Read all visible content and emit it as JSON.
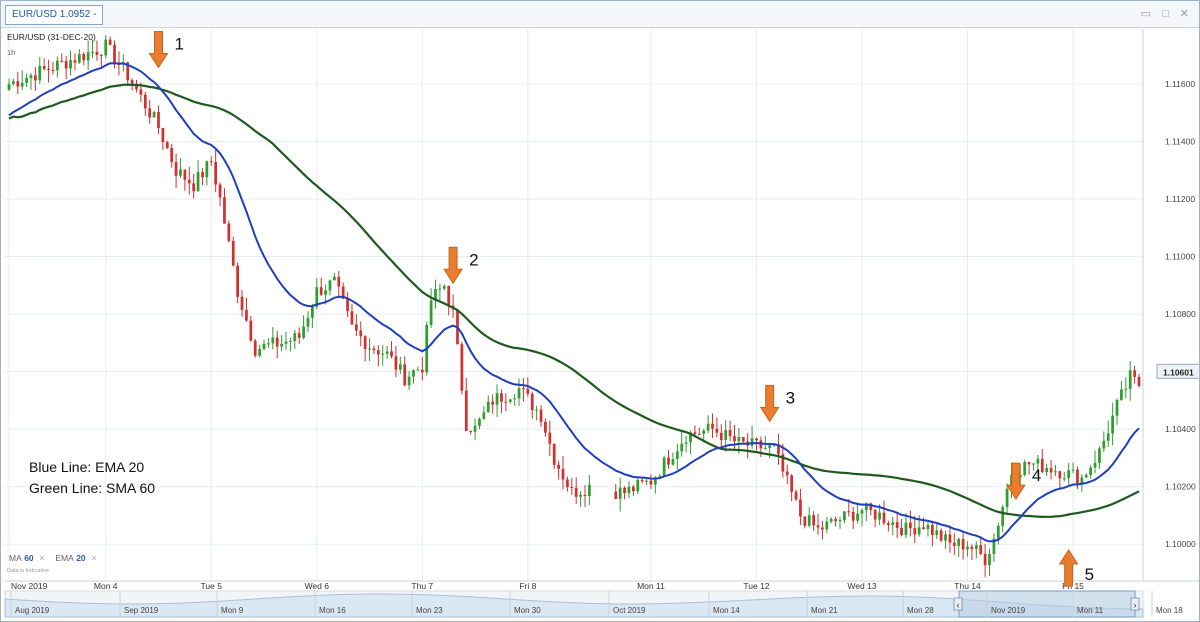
{
  "window": {
    "tab_label": "EUR/USD 1.0952 -",
    "controls": [
      "▭",
      "□",
      "✕"
    ]
  },
  "chart_data": {
    "type": "candlestick",
    "symbol_label": "EUR/USD (31-DEC-20)",
    "interval_label": "1h",
    "ylim": [
      1.099,
      1.1177
    ],
    "y_ticks": [
      "1.11600",
      "1.11400",
      "1.11200",
      "1.11000",
      "1.10800",
      "1.10600",
      "1.10400",
      "1.10200",
      "1.10000"
    ],
    "y_tick_values": [
      1.116,
      1.114,
      1.112,
      1.11,
      1.108,
      1.106,
      1.104,
      1.102,
      1.1
    ],
    "current_price_label": "1.10601",
    "current_price": 1.10601,
    "x_tick_labels": [
      "Nov 2019",
      "Mon 4",
      "Tue 5",
      "Wed 6",
      "Thu 7",
      "Fri 8",
      "Mon 11",
      "Tue 12",
      "Wed 13",
      "Thu 14",
      "Fri 15"
    ],
    "x_tick_positions": [
      0,
      22,
      46,
      70,
      94,
      118,
      146,
      170,
      194,
      218,
      242
    ],
    "total_bars": 258,
    "grid": true,
    "colors": {
      "up": "#2e9e2e",
      "down": "#d32f2f",
      "ema": "#1f3fbf",
      "sma": "#1e5a1e",
      "arrow": "#e87d2f"
    },
    "anchors": [
      [
        0,
        1.116
      ],
      [
        22,
        1.1173
      ],
      [
        27,
        1.1163
      ],
      [
        34,
        1.1145
      ],
      [
        38,
        1.113
      ],
      [
        42,
        1.1125
      ],
      [
        46,
        1.1133
      ],
      [
        48,
        1.112
      ],
      [
        52,
        1.1088
      ],
      [
        56,
        1.1068
      ],
      [
        62,
        1.107
      ],
      [
        66,
        1.1072
      ],
      [
        70,
        1.1088
      ],
      [
        74,
        1.1091
      ],
      [
        78,
        1.1075
      ],
      [
        82,
        1.1069
      ],
      [
        86,
        1.1066
      ],
      [
        90,
        1.1058
      ],
      [
        94,
        1.1062
      ],
      [
        96,
        1.1085
      ],
      [
        99,
        1.109
      ],
      [
        101,
        1.108
      ],
      [
        104,
        1.1042
      ],
      [
        106,
        1.104
      ],
      [
        110,
        1.105
      ],
      [
        116,
        1.1054
      ],
      [
        121,
        1.1045
      ],
      [
        124,
        1.103
      ],
      [
        128,
        1.1018
      ],
      [
        132,
        1.102
      ],
      [
        140,
        1.1018
      ],
      [
        146,
        1.1022
      ],
      [
        150,
        1.103
      ],
      [
        154,
        1.1038
      ],
      [
        160,
        1.104
      ],
      [
        166,
        1.1035
      ],
      [
        170,
        1.1034
      ],
      [
        174,
        1.1033
      ],
      [
        176,
        1.1025
      ],
      [
        180,
        1.101
      ],
      [
        184,
        1.1005
      ],
      [
        188,
        1.1008
      ],
      [
        194,
        1.1012
      ],
      [
        198,
        1.101
      ],
      [
        204,
        1.1005
      ],
      [
        208,
        1.1007
      ],
      [
        214,
        1.1
      ],
      [
        218,
        1.1
      ],
      [
        222,
        1.0995
      ],
      [
        224,
        1.1002
      ],
      [
        228,
        1.1025
      ],
      [
        232,
        1.1028
      ],
      [
        236,
        1.1027
      ],
      [
        240,
        1.1025
      ],
      [
        244,
        1.1023
      ],
      [
        248,
        1.1032
      ],
      [
        252,
        1.1048
      ],
      [
        255,
        1.1058
      ],
      [
        257,
        1.1055
      ]
    ],
    "gaps": [
      [
        133,
        137
      ]
    ],
    "ema_period": 20,
    "sma_period": 60,
    "annotations": [
      {
        "label": "1",
        "bar": 34,
        "price": 1.1165,
        "direction": "down"
      },
      {
        "label": "2",
        "bar": 101,
        "price": 1.109,
        "direction": "down"
      },
      {
        "label": "3",
        "bar": 173,
        "price": 1.1042,
        "direction": "down"
      },
      {
        "label": "4",
        "bar": 229,
        "price": 1.1015,
        "direction": "down"
      },
      {
        "label": "5",
        "bar": 241,
        "price": 1.0998,
        "direction": "up"
      }
    ],
    "legend_text": [
      "Blue Line: EMA 20",
      "Green Line: SMA 60"
    ],
    "indicators": [
      {
        "name": "MA",
        "value": "60",
        "close": "×"
      },
      {
        "name": "EMA",
        "value": "20",
        "close": "×"
      }
    ],
    "data_note": "Data is Indicative",
    "navigator_labels": [
      "Aug 2019",
      "Sep 2019",
      "Mon 9",
      "Mon 16",
      "Mon 23",
      "Mon 30",
      "Oct 2019",
      "Mon 14",
      "Mon 21",
      "Mon 28",
      "Nov 2019",
      "Mon 11",
      "Mon 18"
    ],
    "navigator_nav": [
      "‹",
      "›"
    ]
  }
}
